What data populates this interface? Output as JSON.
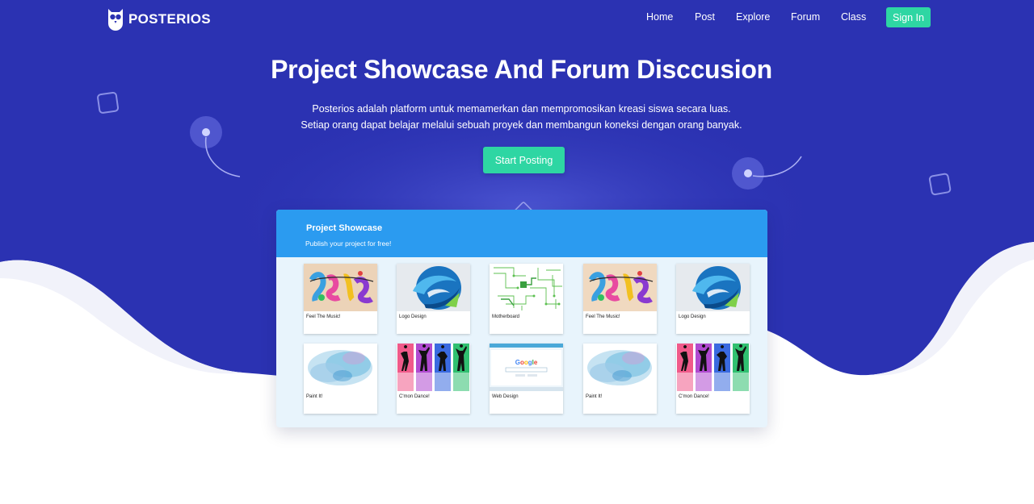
{
  "brand": {
    "name": "POSTERIOS",
    "logo_icon": "owl-icon"
  },
  "nav": {
    "links": [
      "Home",
      "Post",
      "Explore",
      "Forum",
      "Class"
    ],
    "signin_label": "Sign In"
  },
  "hero": {
    "title": "Project Showcase And Forum Disccusion",
    "desc_line1": "Posterios adalah platform untuk memamerkan dan mempromosikan kreasi siswa secara luas.",
    "desc_line2": "Setiap orang dapat belajar melalui sebuah proyek dan membangun koneksi dengan orang banyak.",
    "cta_label": "Start Posting"
  },
  "showcase": {
    "title": "Project Showcase",
    "subtitle": "Publish your project for free!",
    "cards": [
      {
        "label": "Feel The Music!",
        "image": "graffiti-music"
      },
      {
        "label": "Logo Design",
        "image": "blue-swirl-logo"
      },
      {
        "label": "Motherboard",
        "image": "circuit-board"
      },
      {
        "label": "Feel The Music!",
        "image": "graffiti-music"
      },
      {
        "label": "Logo Design",
        "image": "blue-swirl-logo"
      },
      {
        "label": "Paint It!",
        "image": "watercolor-splash"
      },
      {
        "label": "C'mon Dance!",
        "image": "dancers-silhouette"
      },
      {
        "label": "Web Design",
        "image": "google-homepage"
      },
      {
        "label": "Paint It!",
        "image": "watercolor-splash"
      },
      {
        "label": "C'mon Dance!",
        "image": "dancers-silhouette"
      }
    ]
  },
  "colors": {
    "hero_blue": "#2b32b2",
    "accent_green": "#2ed6a3",
    "panel_blue": "#2b9bf0",
    "panel_bg": "#e8f4fc"
  }
}
